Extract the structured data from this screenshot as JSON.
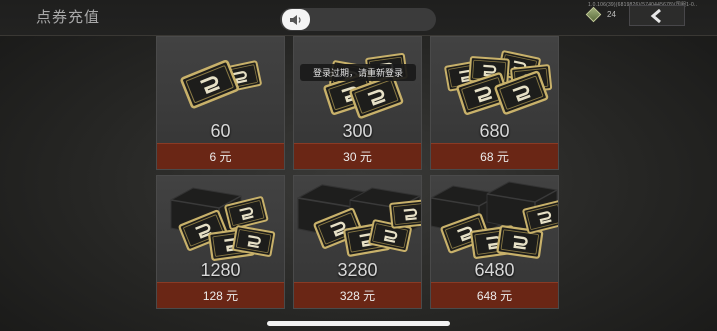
{
  "header": {
    "title": "点券充值",
    "version_text": "1.0.106(39)(6819826)(5740445678)(国服1-0..",
    "balance": "24",
    "back_icon": "chevron-left-icon"
  },
  "notice_bar": {
    "icon": "speaker-icon"
  },
  "toast": {
    "text": "登录过期，请重新登录"
  },
  "packages": [
    {
      "amount": "60",
      "price": "6 元"
    },
    {
      "amount": "300",
      "price": "30 元"
    },
    {
      "amount": "680",
      "price": "68 元"
    },
    {
      "amount": "1280",
      "price": "128 元"
    },
    {
      "amount": "3280",
      "price": "328 元"
    },
    {
      "amount": "6480",
      "price": "648 元"
    }
  ],
  "colors": {
    "price_bg": "#6a2615",
    "card_bg": "#3c3c3c",
    "coupon_gold": "#c8b16a"
  }
}
